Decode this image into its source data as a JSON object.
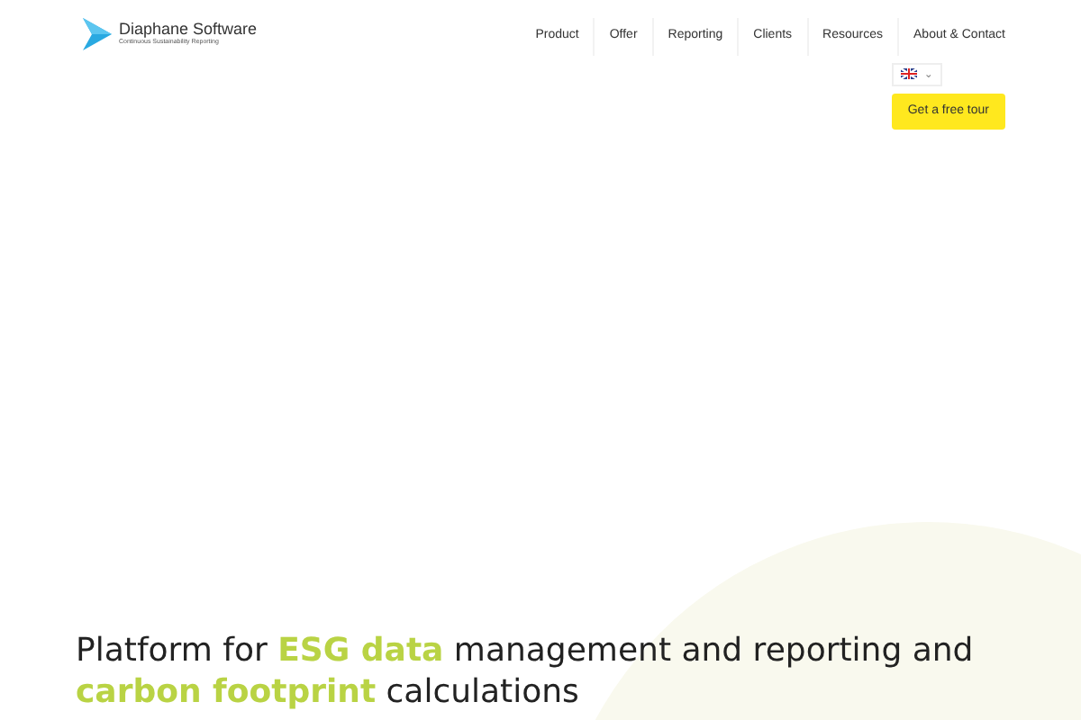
{
  "logo": {
    "name": "Diaphane Software",
    "tagline": "Continuous Sustainability Reporting"
  },
  "nav": [
    {
      "label": "Product"
    },
    {
      "label": "Offer"
    },
    {
      "label": "Reporting"
    },
    {
      "label": "Clients"
    },
    {
      "label": "Resources"
    },
    {
      "label": "About & Contact"
    }
  ],
  "language": {
    "caret": "⌄"
  },
  "cta": {
    "label": "Get a free tour"
  },
  "hero": {
    "heading": "Platform for **ESG data** management and reporting and **carbon footprint** calculations"
  }
}
